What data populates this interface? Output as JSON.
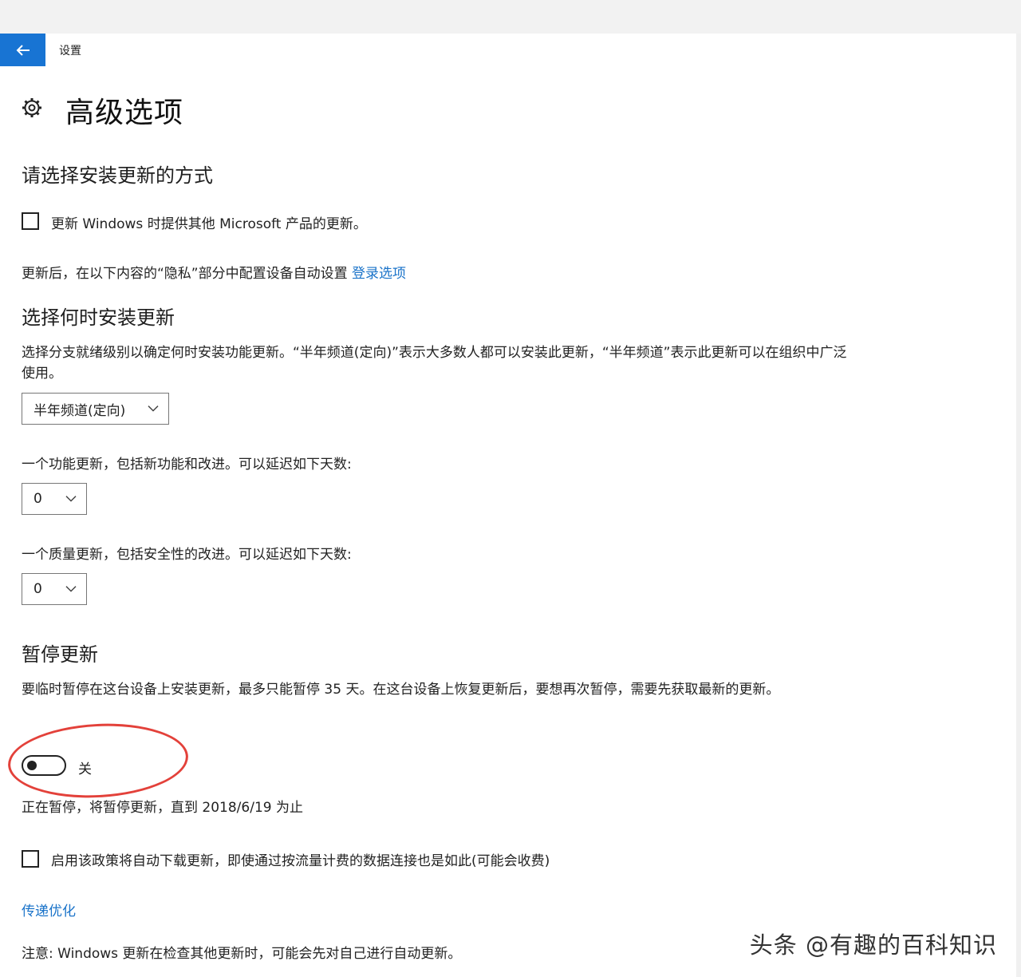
{
  "header": {
    "back_icon": "arrow-left-icon",
    "app_name": "设置"
  },
  "page": {
    "icon": "gear-icon",
    "title": "高级选项"
  },
  "install_method": {
    "heading": "请选择安装更新的方式",
    "checkbox_label": "更新 Windows 时提供其他 Microsoft 产品的更新。",
    "checkbox_checked": false,
    "privacy_text": "更新后，在以下内容的“隐私”部分中配置设备自动设置",
    "privacy_link": "登录选项"
  },
  "install_time": {
    "heading": "选择何时安装更新",
    "description": "选择分支就绪级别以确定何时安装功能更新。“半年频道(定向)”表示大多数人都可以安装此更新，“半年频道”表示此更新可以在组织中广泛使用。",
    "branch_select_value": "半年频道(定向)",
    "feature_update_label": "一个功能更新，包括新功能和改进。可以延迟如下天数:",
    "feature_defer_value": "0",
    "quality_update_label": "一个质量更新，包括安全性的改进。可以延迟如下天数:",
    "quality_defer_value": "0"
  },
  "pause": {
    "heading": "暂停更新",
    "description": "要临时暂停在这台设备上安装更新，最多只能暂停 35 天。在这台设备上恢复更新后，要想再次暂停，需要先获取最新的更新。",
    "toggle_state_label": "关",
    "toggle_on": false,
    "status_text": "正在暂停，将暂停更新，直到 2018/6/19 为止"
  },
  "metered": {
    "checkbox_label": "启用该政策将自动下载更新，即使通过按流量计费的数据连接也是如此(可能会收费)",
    "checkbox_checked": false
  },
  "delivery": {
    "link": "传递优化",
    "note": "注意: Windows 更新在检查其他更新时，可能会先对自己进行自动更新。"
  },
  "watermark": "头条 @有趣的百科知识",
  "colors": {
    "accent": "#1874d3",
    "link": "#1a73c9",
    "annotation": "#e3413a"
  }
}
